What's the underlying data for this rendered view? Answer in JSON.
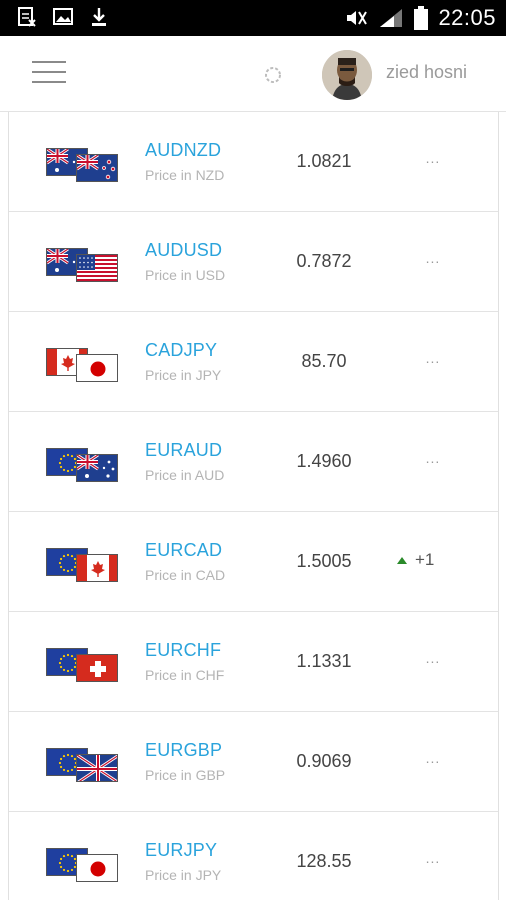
{
  "status_bar": {
    "time": "22:05",
    "icons": [
      "sim-error-icon",
      "image-icon",
      "download-icon",
      "mute-icon",
      "signal-icon",
      "battery-icon"
    ]
  },
  "header": {
    "username": "zied hosni",
    "icons": [
      "menu-icon",
      "spinner-icon",
      "avatar"
    ]
  },
  "pairs": [
    {
      "name": "AUDNZD",
      "sub": "Price in NZD",
      "price": "1.0821",
      "change": "...",
      "flags": [
        "AU",
        "NZ"
      ]
    },
    {
      "name": "AUDUSD",
      "sub": "Price in USD",
      "price": "0.7872",
      "change": "...",
      "flags": [
        "AU",
        "US"
      ]
    },
    {
      "name": "CADJPY",
      "sub": "Price in JPY",
      "price": "85.70",
      "change": "...",
      "flags": [
        "CA",
        "JP"
      ]
    },
    {
      "name": "EURAUD",
      "sub": "Price in AUD",
      "price": "1.4960",
      "change": "...",
      "flags": [
        "EU",
        "AU"
      ]
    },
    {
      "name": "EURCAD",
      "sub": "Price in CAD",
      "price": "1.5005",
      "change": "+1",
      "direction": "up",
      "flags": [
        "EU",
        "CA"
      ]
    },
    {
      "name": "EURCHF",
      "sub": "Price in CHF",
      "price": "1.1331",
      "change": "...",
      "flags": [
        "EU",
        "CH"
      ]
    },
    {
      "name": "EURGBP",
      "sub": "Price in GBP",
      "price": "0.9069",
      "change": "...",
      "flags": [
        "EU",
        "GB"
      ]
    },
    {
      "name": "EURJPY",
      "sub": "Price in JPY",
      "price": "128.55",
      "change": "...",
      "flags": [
        "EU",
        "JP"
      ]
    }
  ],
  "colors": {
    "pair_name": "#2aa3dc",
    "up": "#2a8a2a"
  }
}
